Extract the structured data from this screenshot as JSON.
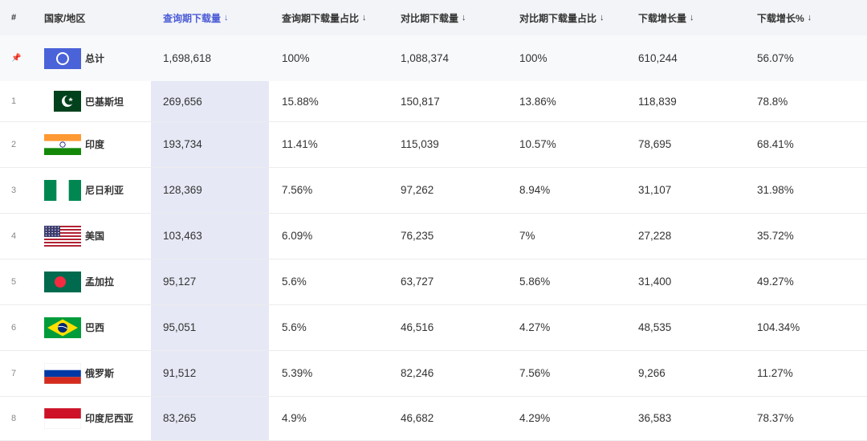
{
  "header": {
    "idx": "#",
    "country": "国家/地区",
    "query_downloads": "查询期下载量",
    "query_share": "查询期下载量占比",
    "compare_downloads": "对比期下载量",
    "compare_share": "对比期下载量占比",
    "growth": "下载增长量",
    "growth_pct": "下载增长%",
    "sort_arrow": "↓"
  },
  "summary": {
    "pin": "📌",
    "name": "总计",
    "query_downloads": "1,698,618",
    "query_share": "100%",
    "compare_downloads": "1,088,374",
    "compare_share": "100%",
    "growth": "610,244",
    "growth_pct": "56.07%"
  },
  "rows": [
    {
      "idx": "1",
      "name": "巴基斯坦",
      "flag": "pakistan-flag",
      "q": "269,656",
      "qs": "15.88%",
      "c": "150,817",
      "cs": "13.86%",
      "g": "118,839",
      "gp": "78.8%"
    },
    {
      "idx": "2",
      "name": "印度",
      "flag": "india-flag",
      "q": "193,734",
      "qs": "11.41%",
      "c": "115,039",
      "cs": "10.57%",
      "g": "78,695",
      "gp": "68.41%"
    },
    {
      "idx": "3",
      "name": "尼日利亚",
      "flag": "nigeria-flag",
      "q": "128,369",
      "qs": "7.56%",
      "c": "97,262",
      "cs": "8.94%",
      "g": "31,107",
      "gp": "31.98%"
    },
    {
      "idx": "4",
      "name": "美国",
      "flag": "usa-flag",
      "q": "103,463",
      "qs": "6.09%",
      "c": "76,235",
      "cs": "7%",
      "g": "27,228",
      "gp": "35.72%"
    },
    {
      "idx": "5",
      "name": "孟加拉",
      "flag": "bangladesh-flag",
      "q": "95,127",
      "qs": "5.6%",
      "c": "63,727",
      "cs": "5.86%",
      "g": "31,400",
      "gp": "49.27%"
    },
    {
      "idx": "6",
      "name": "巴西",
      "flag": "brazil-flag",
      "q": "95,051",
      "qs": "5.6%",
      "c": "46,516",
      "cs": "4.27%",
      "g": "48,535",
      "gp": "104.34%"
    },
    {
      "idx": "7",
      "name": "俄罗斯",
      "flag": "russia-flag",
      "q": "91,512",
      "qs": "5.39%",
      "c": "82,246",
      "cs": "7.56%",
      "g": "9,266",
      "gp": "11.27%"
    },
    {
      "idx": "8",
      "name": "印度尼西亚",
      "flag": "indonesia-flag",
      "q": "83,265",
      "qs": "4.9%",
      "c": "46,682",
      "cs": "4.29%",
      "g": "36,583",
      "gp": "78.37%"
    }
  ],
  "colors": {
    "accent": "#4a5bd6",
    "highlight_column": "#e6e8f5",
    "header_bg": "#f3f4f7"
  }
}
